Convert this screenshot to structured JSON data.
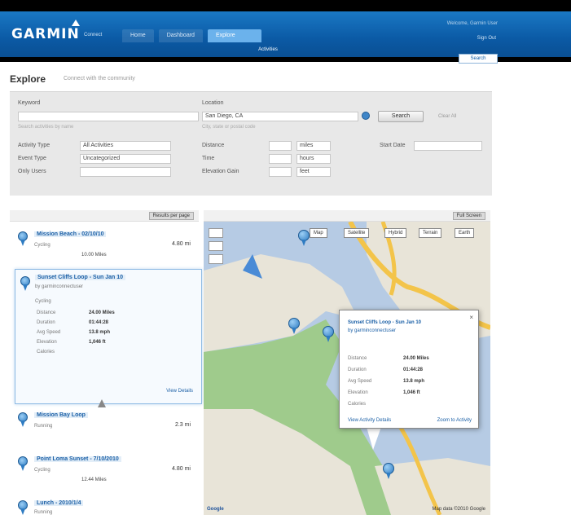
{
  "brand": {
    "logo": "GARMIN",
    "sub": "Connect"
  },
  "nav": {
    "tabs": [
      "Home",
      "Dashboard",
      "Explore"
    ],
    "active_tab": "Explore",
    "sub_item": "Activities",
    "account_link": "Welcome, Garmin User",
    "sign_out": "Sign Out",
    "search_button": "Search"
  },
  "page": {
    "title": "Explore",
    "subtitle": "Connect with the community"
  },
  "filters": {
    "keyword_label": "Keyword",
    "keyword_value": "",
    "keyword_hint": "Search activities by name",
    "location_label": "Location",
    "location_value": "San Diego, CA",
    "location_hint": "City, state or postal code",
    "search_button": "Search",
    "clear_link": "Clear All",
    "activity_type_label": "Activity Type",
    "activity_type_value": "All Activities",
    "event_type_label": "Event Type",
    "event_type_value": "Uncategorized",
    "distance_label": "Distance",
    "distance_from": "",
    "distance_to": "miles",
    "time_label": "Time",
    "time_to": "hours",
    "elevation_label": "Elevation Gain",
    "elevation_to": "feet",
    "date_label": "Start Date",
    "date_value": "",
    "users_label": "Only Users",
    "users_value": ""
  },
  "list": {
    "header_button": "Results per page",
    "items": [
      {
        "title": "Mission Beach - 02/10/10",
        "meta": "Cycling",
        "value": "10.00 Miles",
        "distance": "4.80 mi"
      },
      {
        "title": "Sunset Cliffs Loop - Sun Jan 10",
        "sub": "by garminconnectuser",
        "meta": "Cycling"
      },
      {
        "title": "Mission Bay Loop",
        "meta": "Running",
        "value": "",
        "distance": "2.3 mi"
      },
      {
        "title": "Point Loma Sunset - 7/10/2010",
        "meta": "Cycling",
        "value": "12.44 Miles",
        "distance": "4.80 mi"
      },
      {
        "title": "Lunch - 2010/1/4",
        "meta": "Running",
        "value": "",
        "distance": ""
      }
    ],
    "expanded": {
      "rows": [
        {
          "label": "Distance",
          "value": "24.00 Miles"
        },
        {
          "label": "Duration",
          "value": "01:44:28"
        },
        {
          "label": "Avg Speed",
          "value": "13.8 mph"
        },
        {
          "label": "Elevation",
          "value": "1,046 ft"
        },
        {
          "label": "Calories",
          "value": ""
        }
      ],
      "link": "View Details"
    }
  },
  "map": {
    "header_button": "Full Screen",
    "controls": [
      "Map",
      "Satellite",
      "Hybrid",
      "Terrain",
      "Earth"
    ],
    "popup": {
      "title": "Sunset Cliffs Loop - Sun Jan 10",
      "sub": "by garminconnectuser",
      "rows": [
        {
          "label": "Distance",
          "value": "24.00 Miles"
        },
        {
          "label": "Duration",
          "value": "01:44:28"
        },
        {
          "label": "Avg Speed",
          "value": "13.8 mph"
        },
        {
          "label": "Elevation",
          "value": "1,046 ft"
        },
        {
          "label": "Calories",
          "value": ""
        }
      ],
      "link_left": "View Activity Details",
      "link_right": "Zoom to Activity"
    },
    "footer_left": "Google",
    "footer_right": "Map data ©2010 Google",
    "colors": {
      "water": "#b6cbe4",
      "land": "#e8e4d8",
      "park": "#9fcb8c",
      "road": "#f3c44a"
    }
  }
}
